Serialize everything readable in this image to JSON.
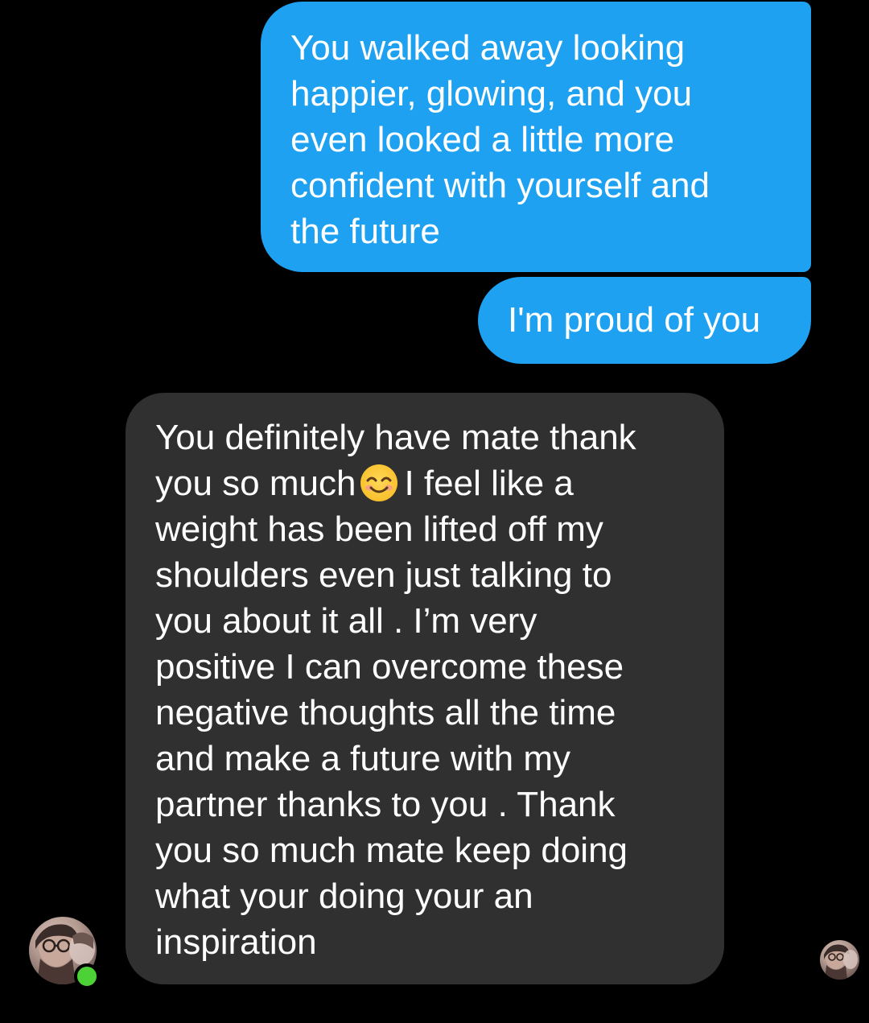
{
  "conversation": {
    "messages": [
      {
        "direction": "outgoing",
        "text": "You walked away looking\nhappier, glowing, and you\neven looked a little more\nconfident with yourself and\nthe future"
      },
      {
        "direction": "outgoing",
        "text": "I'm proud of you"
      },
      {
        "direction": "incoming",
        "text_before_emoji": "You definitely have mate thank\nyou so much",
        "emoji": "smiling-face-with-smiling-eyes",
        "text_after_emoji": "I feel like a\nweight has been lifted off my\nshoulders even just talking to\nyou about it all . I’m very\npositive I can overcome these\nnegative thoughts all the time\nand make a future with my\npartner thanks to you . Thank\nyou so much mate keep doing\nwhat your doing your an\ninspiration"
      }
    ],
    "contact": {
      "online": true
    }
  },
  "colors": {
    "background": "#000000",
    "outgoing_bubble": "#1ea1f1",
    "incoming_bubble": "#303030",
    "text": "#ffffff",
    "online_indicator": "#4cd137"
  }
}
